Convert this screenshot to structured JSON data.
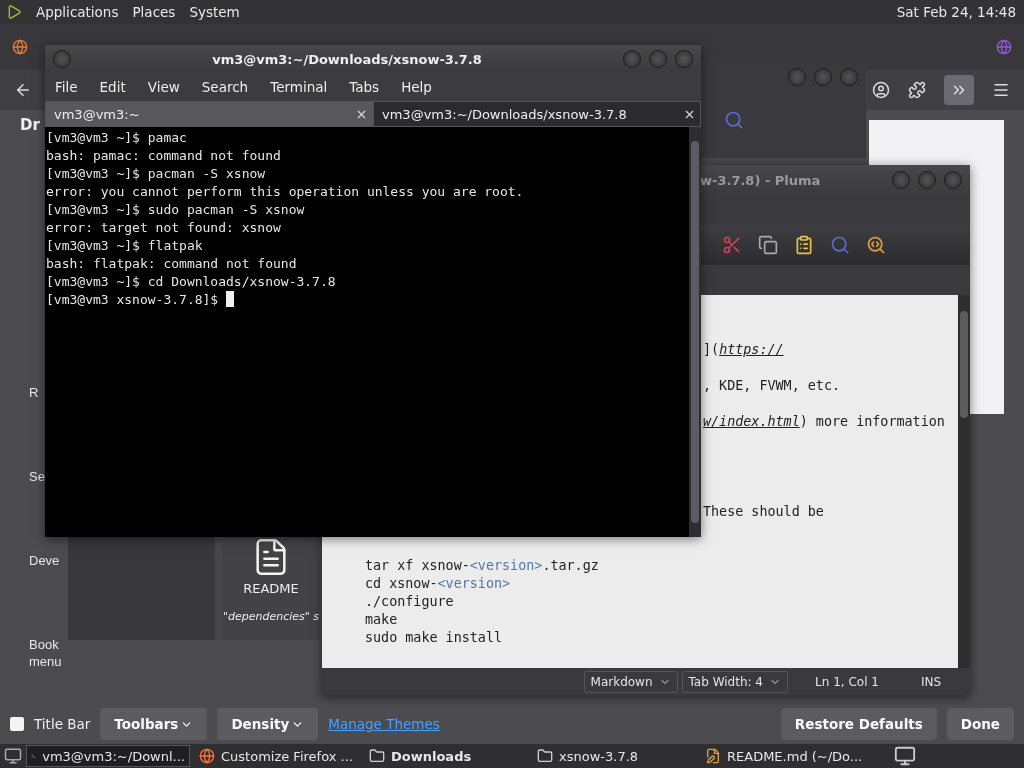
{
  "top_panel": {
    "menus": [
      "Applications",
      "Places",
      "System"
    ],
    "clock": "Sat Feb 24, 14:48"
  },
  "firefox": {
    "palette_heading": "Dr",
    "palette_items": [
      {
        "lines": [
          "R"
        ]
      },
      {
        "lines": [
          "Se"
        ]
      },
      {
        "lines": [
          "Deve"
        ]
      },
      {
        "lines": [
          "Book",
          "menu"
        ]
      }
    ],
    "bottom_bar": {
      "title_bar": {
        "label": "Title Bar",
        "checked": false
      },
      "toolbars": "Toolbars",
      "density": "Density",
      "manage_themes": "Manage Themes",
      "restore": "Restore Defaults",
      "done": "Done"
    }
  },
  "file_manager": {
    "files": [
      {
        "kind": "blank"
      },
      {
        "name": "README",
        "note": "\"dependencies\" s"
      }
    ]
  },
  "terminal": {
    "title": "vm3@vm3:~/Downloads/xsnow-3.7.8",
    "menu": [
      "File",
      "Edit",
      "View",
      "Search",
      "Terminal",
      "Tabs",
      "Help"
    ],
    "tabs": [
      {
        "label": "vm3@vm3:~",
        "selected": false
      },
      {
        "label": "vm3@vm3:~/Downloads/xsnow-3.7.8",
        "selected": true
      }
    ],
    "lines": [
      "[vm3@vm3 ~]$ pamac",
      "bash: pamac: command not found",
      "[vm3@vm3 ~]$ pacman -S xsnow",
      "error: you cannot perform this operation unless you are root.",
      "[vm3@vm3 ~]$ sudo pacman -S xsnow",
      "error: target not found: xsnow",
      "[vm3@vm3 ~]$ flatpak",
      "bash: flatpak: command not found",
      "[vm3@vm3 ~]$ cd Downloads/xsnow-3.7.8",
      "[vm3@vm3 xsnow-3.7.8]$ "
    ]
  },
  "pluma": {
    "title": "w-3.7.8) - Pluma",
    "lines": [
      {
        "kind": "fragment",
        "segments": [
          {
            "kind": "plain",
            "text": "]("
          },
          {
            "kind": "link",
            "text": "https://"
          }
        ]
      },
      {
        "kind": "fragment",
        "segments": [
          {
            "kind": "plain",
            "text": ", KDE, FVWM, etc."
          }
        ]
      },
      {
        "kind": "fragment",
        "segments": [
          {
            "kind": "link",
            "text": "w/index.html"
          },
          {
            "kind": "plain",
            "text": ") more information"
          }
        ]
      },
      {
        "kind": "fragment",
        "segments": [
          {
            "kind": "plain",
            "text": "These should be"
          }
        ]
      },
      {
        "kind": "code",
        "segments": [
          {
            "kind": "plain",
            "text": "tar xf xsnow-"
          },
          {
            "kind": "tag",
            "text": "<version>"
          },
          {
            "kind": "plain",
            "text": ".tar.gz"
          }
        ]
      },
      {
        "kind": "code",
        "segments": [
          {
            "kind": "plain",
            "text": "cd xsnow-"
          },
          {
            "kind": "tag",
            "text": "<version>"
          }
        ]
      },
      {
        "kind": "code",
        "segments": [
          {
            "kind": "plain",
            "text": "./configure"
          }
        ]
      },
      {
        "kind": "code",
        "segments": [
          {
            "kind": "plain",
            "text": "make"
          }
        ]
      },
      {
        "kind": "code",
        "segments": [
          {
            "kind": "plain",
            "text": "sudo make install"
          }
        ]
      }
    ],
    "status": {
      "language": "Markdown",
      "tab_width": "Tab Width:  4",
      "position": "Ln 1, Col 1",
      "mode": "INS"
    }
  },
  "taskbar": [
    {
      "kind": "terminal",
      "label": "vm3@vm3:~/Downl...",
      "selected": true,
      "bold": false
    },
    {
      "kind": "browser",
      "label": "Customize Firefox ...",
      "selected": false,
      "bold": false
    },
    {
      "kind": "folder",
      "label": "Downloads",
      "selected": false,
      "bold": true
    },
    {
      "kind": "folder",
      "label": "xsnow-3.7.8",
      "selected": false,
      "bold": false
    },
    {
      "kind": "editor",
      "label": "README.md (~/Do...",
      "selected": false,
      "bold": false
    }
  ]
}
